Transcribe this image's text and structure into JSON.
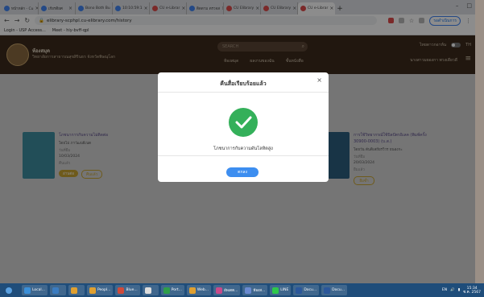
{
  "browser": {
    "tabs": [
      {
        "label": "หน้าหลัก - Cu",
        "color": "#4285f4"
      },
      {
        "label": "เกียรติยศ",
        "color": "#4285f4"
      },
      {
        "label": "Bono Both Bu",
        "color": "#4285f4"
      },
      {
        "label": "10:10:59:1",
        "color": "#4285f4"
      },
      {
        "label": "CU e-Librar",
        "color": "#e04b4b"
      },
      {
        "label": "ติดตาม ตรวจส",
        "color": "#4285f4"
      },
      {
        "label": "CU Elibrary",
        "color": "#e04b4b"
      },
      {
        "label": "CU Elibrary",
        "color": "#e04b4b"
      },
      {
        "label": "CU e-Librar",
        "color": "#e04b4b",
        "active": true
      }
    ],
    "tab_close": "×",
    "new_tab": "+",
    "url": "elibrary-scphpl.cu-elibrary.com/history",
    "profile_label": "รอดำเนินการ",
    "bookmarks": [
      "Login - USP Access...",
      "Meet - hiy-bvff-qpl"
    ]
  },
  "site": {
    "library_name": "ห้องสมุด",
    "library_subtitle": "วิทยาลัยการสาธารณสุขสิรินธร จังหวัดพิษณุโลก",
    "search_placeholder": "SEARCH",
    "menu": [
      "ห้องสมุด",
      "ผลงานของฉัน",
      "ชั้นหนังสือ"
    ],
    "user_top": "ไทยดาวกอาห์น",
    "lang": "TH",
    "username": "นางสาวมยองกา พวงเดียวดี",
    "books": [
      {
        "title": "โภชนาการกับความไม่ติดต่อ",
        "author": "โดยไม่ ภาวัฒนธีเนต",
        "status": "วันที่ยืม",
        "date": "10/03/2024",
        "status2": "คืนแล้ว",
        "btn1": "อ่านต่อ",
        "btn2": "คืนแล้ว"
      },
      {
        "title": "การใช้วิทยากรณ์ใช้บิลปัตรอิเลค (พิมพ์ครั้ง 30900-0003) (บ.ส.)",
        "author": "โดยวัน ตันติเสถียรวิวร ยนองกะ",
        "status": "วันที่ยืม",
        "date": "20/03/2024",
        "status2": "ยืมแล้ว",
        "btn1": "ยืมซ้ำ",
        "btn2": ""
      }
    ]
  },
  "modal": {
    "title": "คืนสื่อเรียบร้อยแล้ว",
    "message": "โภชนาการกับความดันโลหิตสูง",
    "ok_button": "ตกลง",
    "close": "×",
    "check_color": "#34b05a"
  },
  "taskbar": {
    "items": [
      "Local...",
      "",
      "",
      "Peopl...",
      "Blue...",
      "",
      "Port...",
      "Web...",
      "อัพเดต...",
      "ห้องส...",
      "LINE",
      "Docu...",
      "Docu..."
    ],
    "lang": "EN",
    "time": "15:34",
    "date": "ซ.ค. 2567"
  }
}
